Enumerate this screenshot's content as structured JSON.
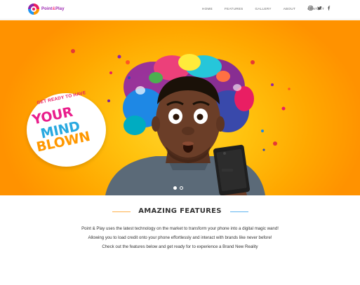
{
  "header": {
    "logo_text_1": "Point",
    "logo_text_amp": "&",
    "logo_text_2": "Play",
    "nav": [
      {
        "label": "HOME"
      },
      {
        "label": "FEATURES"
      },
      {
        "label": "GALLERY"
      },
      {
        "label": "ABOUT"
      },
      {
        "label": "CONTACT"
      }
    ],
    "socials": [
      "instagram-icon",
      "twitter-icon",
      "facebook-icon"
    ]
  },
  "hero": {
    "badge_small": "GET READY TO HAVE",
    "badge_line1": "YOUR",
    "badge_line2": "MIND",
    "badge_line3": "BLOWN",
    "slides": 2,
    "active_slide": 1
  },
  "features": {
    "title": "AMAZING FEATURES",
    "line1": "Point & Play uses the latest technology on the market to transform your phone into a digital magic wand!",
    "line2": "Allowing you to load credit onto your phone effortlessly and interact with brands like never before!",
    "line3": "Check out the features below and get ready for to experience a Brand New Reality"
  },
  "colors": {
    "hero_yellow": "#ffc20e",
    "brand_pink": "#e91e8c",
    "brand_blue": "#29a9e0",
    "brand_orange": "#ff9800",
    "rule_orange": "#ffb04a",
    "rule_blue": "#5fb4f0"
  }
}
